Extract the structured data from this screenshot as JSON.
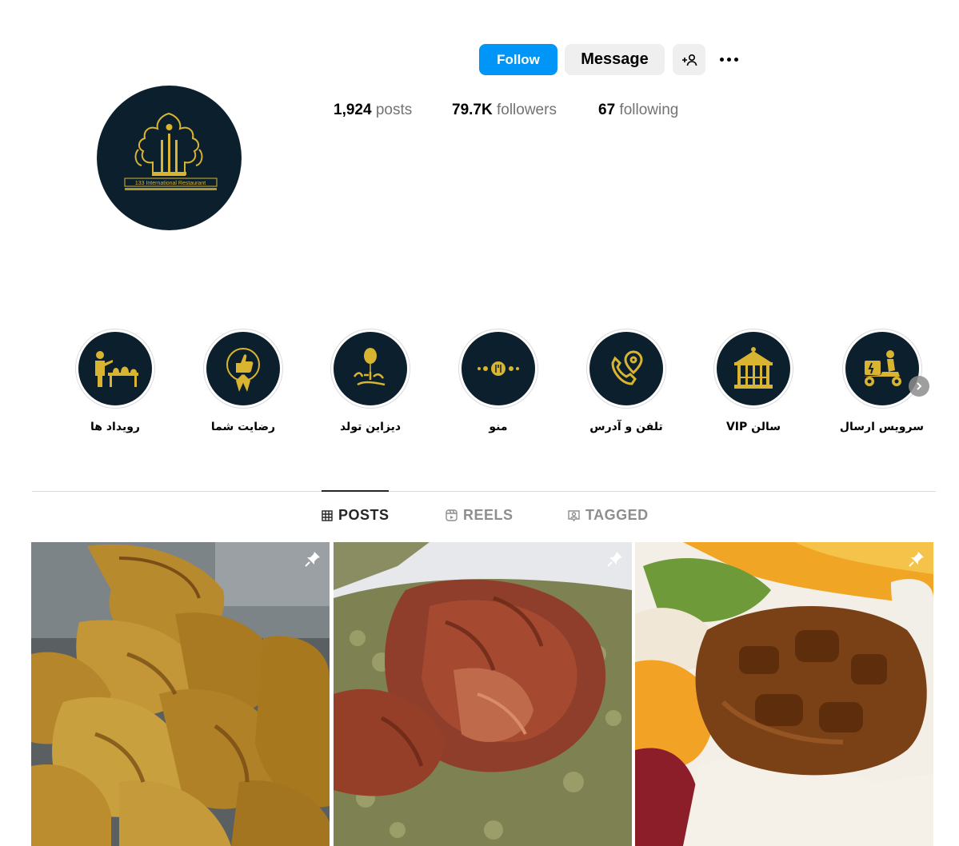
{
  "header": {
    "follow_label": "Follow",
    "message_label": "Message",
    "suggest_icon": "add-person-icon",
    "more_icon": "more-options-icon"
  },
  "stats": {
    "posts_count": "1,924",
    "posts_label": "posts",
    "followers_count": "79.7K",
    "followers_label": "followers",
    "following_count": "67",
    "following_label": "following"
  },
  "avatar": {
    "logo_text": "133 International Restaurant"
  },
  "highlights": [
    {
      "label": "سرویس ارسال",
      "icon": "delivery-scooter-icon"
    },
    {
      "label": "سالن VIP",
      "icon": "gazebo-icon"
    },
    {
      "label": "تلفن و آدرس",
      "icon": "phone-location-icon"
    },
    {
      "label": "منو",
      "icon": "menu-ornament-icon"
    },
    {
      "label": "دیزاین تولد",
      "icon": "happy-birthday-icon"
    },
    {
      "label": "رضایت شما",
      "icon": "thumbs-up-badge-icon"
    },
    {
      "label": "رویداد ها",
      "icon": "waiter-buffet-icon"
    }
  ],
  "tabs": [
    {
      "label": "POSTS",
      "icon": "grid-icon",
      "active": true
    },
    {
      "label": "REELS",
      "icon": "reels-icon",
      "active": false
    },
    {
      "label": "TAGGED",
      "icon": "tagged-icon",
      "active": false
    }
  ],
  "posts": [
    {
      "subject": "fried chicken pieces",
      "pinned": true
    },
    {
      "subject": "lamb shank over herb rice",
      "pinned": true
    },
    {
      "subject": "stew over saffron rice",
      "pinned": true
    }
  ],
  "colors": {
    "follow_blue": "#0095f6",
    "highlight_navy": "#0c1f2c",
    "gold": "#d9b431"
  }
}
